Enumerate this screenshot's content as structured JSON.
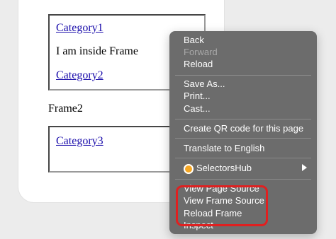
{
  "frame1": {
    "link1": "Category1",
    "text": "I am inside Frame",
    "link2": "Category2"
  },
  "frame2_label": "Frame2",
  "frame3": {
    "link": "Category3"
  },
  "context_menu": {
    "back": "Back",
    "forward": "Forward",
    "reload": "Reload",
    "save_as": "Save As...",
    "print": "Print...",
    "cast": "Cast...",
    "create_qr": "Create QR code for this page",
    "translate": "Translate to English",
    "selectorshub": "SelectorsHub",
    "view_page_source": "View Page Source",
    "view_frame_source": "View Frame Source",
    "reload_frame": "Reload Frame",
    "inspect": "Inspect"
  },
  "colors": {
    "menu_bg": "#6c6c6c",
    "highlight": "#e02020",
    "link": "#1a0dab"
  },
  "icons": {
    "selectorshub": "selectorshub-icon",
    "submenu": "chevron-right-icon"
  }
}
